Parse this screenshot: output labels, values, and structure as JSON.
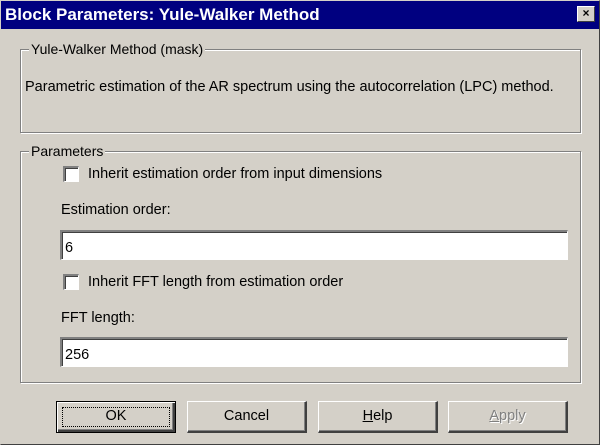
{
  "window": {
    "title": "Block Parameters: Yule-Walker Method",
    "close_glyph": "×"
  },
  "mask_group": {
    "legend": "Yule-Walker Method (mask)",
    "description": "Parametric estimation of the AR spectrum using the autocorrelation (LPC) method."
  },
  "params_group": {
    "legend": "Parameters",
    "inherit_order_label": "Inherit estimation order from input dimensions",
    "inherit_order_checked": false,
    "order_label": "Estimation order:",
    "order_value": "6",
    "inherit_fft_label": "Inherit FFT length from estimation order",
    "inherit_fft_checked": false,
    "fft_label": "FFT length:",
    "fft_value": "256"
  },
  "buttons": {
    "ok": "OK",
    "cancel": "Cancel",
    "help_mnemonic": "H",
    "help_rest": "elp",
    "apply_mnemonic": "A",
    "apply_rest": "pply"
  }
}
